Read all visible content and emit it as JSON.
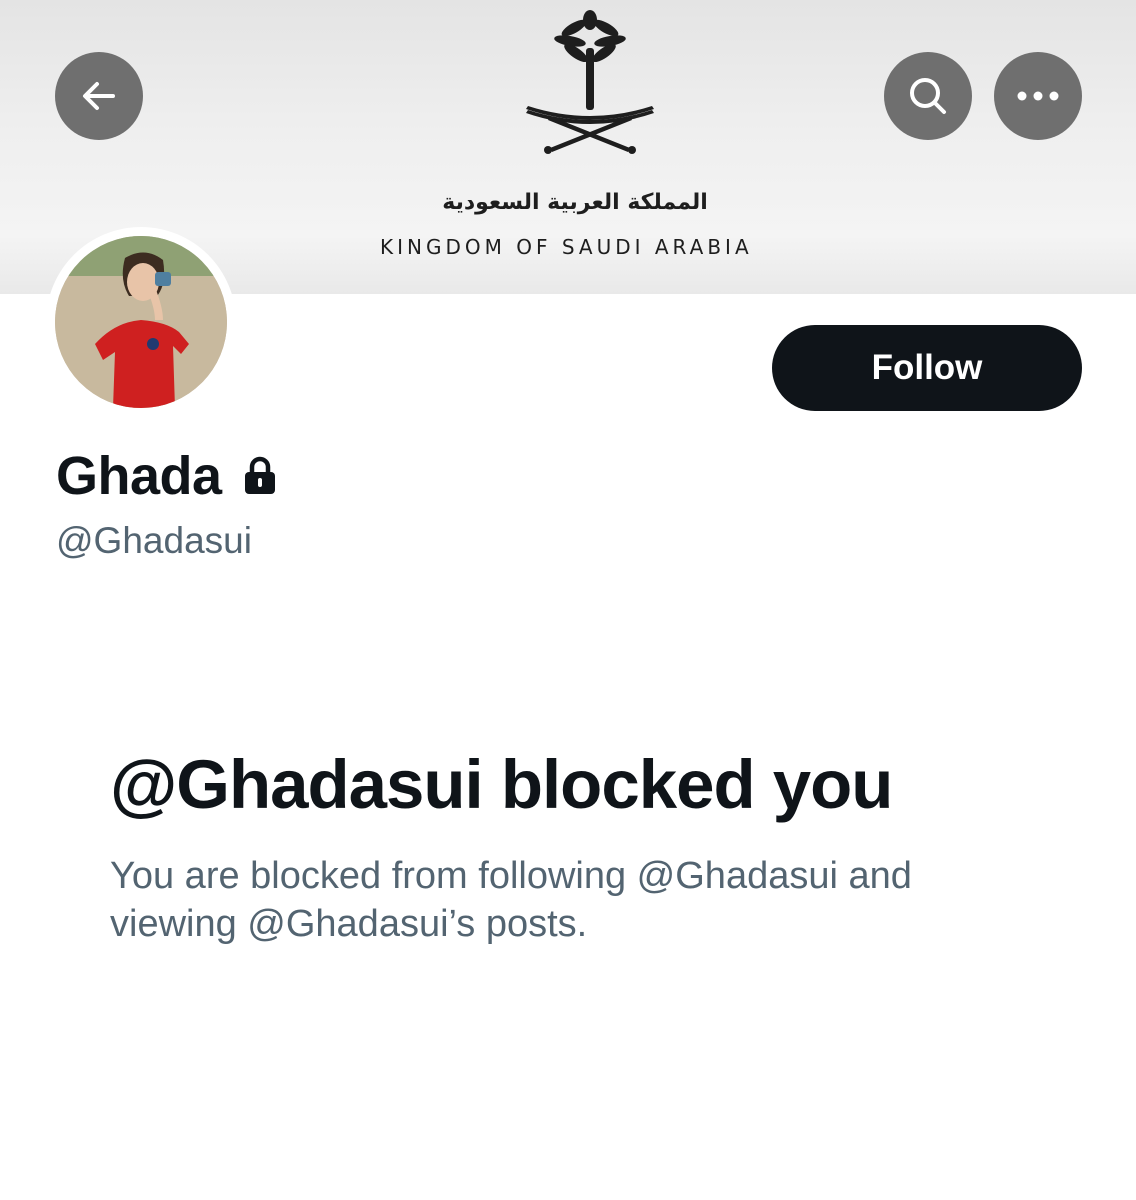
{
  "banner": {
    "arabic_text": "المملكة العربية السعودية",
    "english_text": "KINGDOM OF SAUDI ARABIA",
    "emblem_icon": "palm-and-swords-emblem"
  },
  "nav": {
    "back_icon": "arrow-left-icon",
    "search_icon": "search-icon",
    "more_icon": "more-horizontal-icon"
  },
  "profile": {
    "display_name": "Ghada",
    "handle": "@Ghadasui",
    "protected_icon": "lock-icon",
    "follow_label": "Follow"
  },
  "blocked": {
    "title": "@Ghadasui blocked you",
    "description": "You are blocked from following @Ghadasui and viewing @Ghadasui’s posts."
  },
  "colors": {
    "primary_text": "#0f1419",
    "secondary_text": "#536471",
    "button_bg": "#0f1419",
    "overlay_button": "#6f6f6f"
  }
}
